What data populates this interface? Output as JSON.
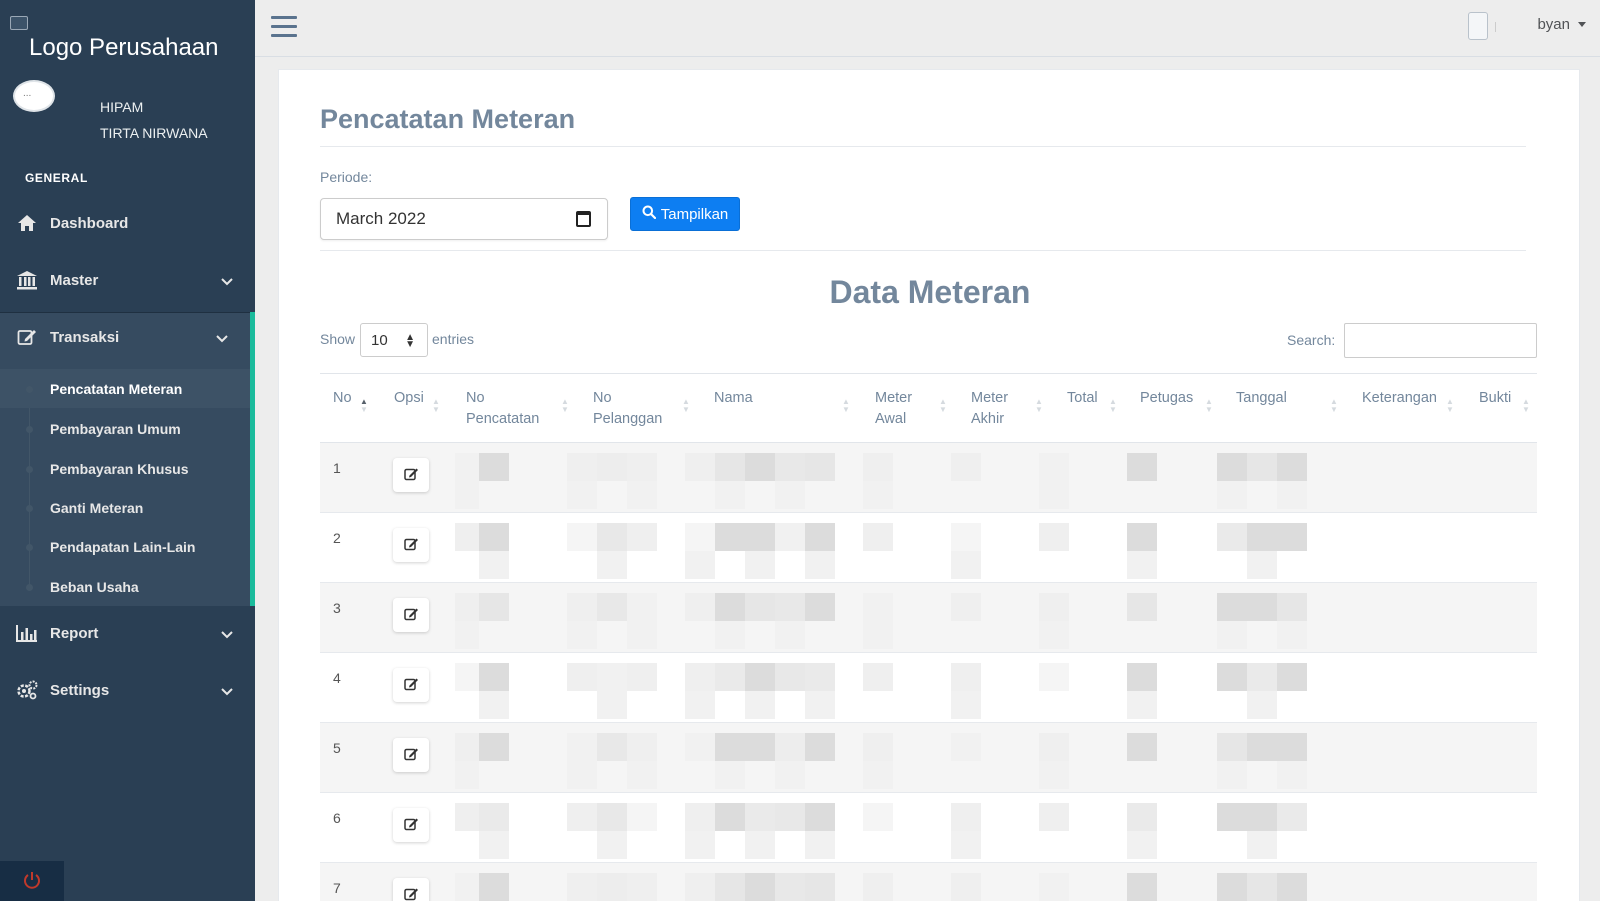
{
  "sidebar": {
    "logo_alt": "Logo Perusahaan",
    "profile_alt": "...",
    "org_line1": "HIPAM",
    "org_line2": "TIRTA NIRWANA",
    "section": "GENERAL",
    "menu": {
      "dashboard": "Dashboard",
      "master": "Master",
      "transaksi": "Transaksi",
      "report": "Report",
      "settings": "Settings"
    },
    "submenu": [
      "Pencatatan Meteran",
      "Pembayaran Umum",
      "Pembayaran Khusus",
      "Ganti Meteran",
      "Pendapatan Lain-Lain",
      "Beban Usaha"
    ],
    "accent_color": "#1abb9c"
  },
  "topnav": {
    "username": "byan"
  },
  "page": {
    "title": "Pencatatan Meteran",
    "periode_label": "Periode:",
    "periode_value": "March 2022",
    "button_label": "Tampilkan",
    "button_color": "#0d7ef2",
    "data_title": "Data Meteran"
  },
  "table": {
    "show_label": "Show",
    "entries_value": "10",
    "entries_label": "entries",
    "search_label": "Search:",
    "columns": [
      {
        "line1": "No",
        "line2": ""
      },
      {
        "line1": "Opsi",
        "line2": ""
      },
      {
        "line1": "No",
        "line2": "Pencatatan"
      },
      {
        "line1": "No",
        "line2": "Pelanggan"
      },
      {
        "line1": "Nama",
        "line2": ""
      },
      {
        "line1": "Meter",
        "line2": "Awal"
      },
      {
        "line1": "Meter",
        "line2": "Akhir"
      },
      {
        "line1": "Total",
        "line2": ""
      },
      {
        "line1": "Petugas",
        "line2": ""
      },
      {
        "line1": "Tanggal",
        "line2": ""
      },
      {
        "line1": "Keterangan",
        "line2": ""
      },
      {
        "line1": "Bukti",
        "line2": ""
      }
    ],
    "rows": [
      "1",
      "2",
      "3",
      "4",
      "5",
      "6",
      "7"
    ],
    "sorted_column": "No",
    "row_content": "pixelated/redacted"
  }
}
